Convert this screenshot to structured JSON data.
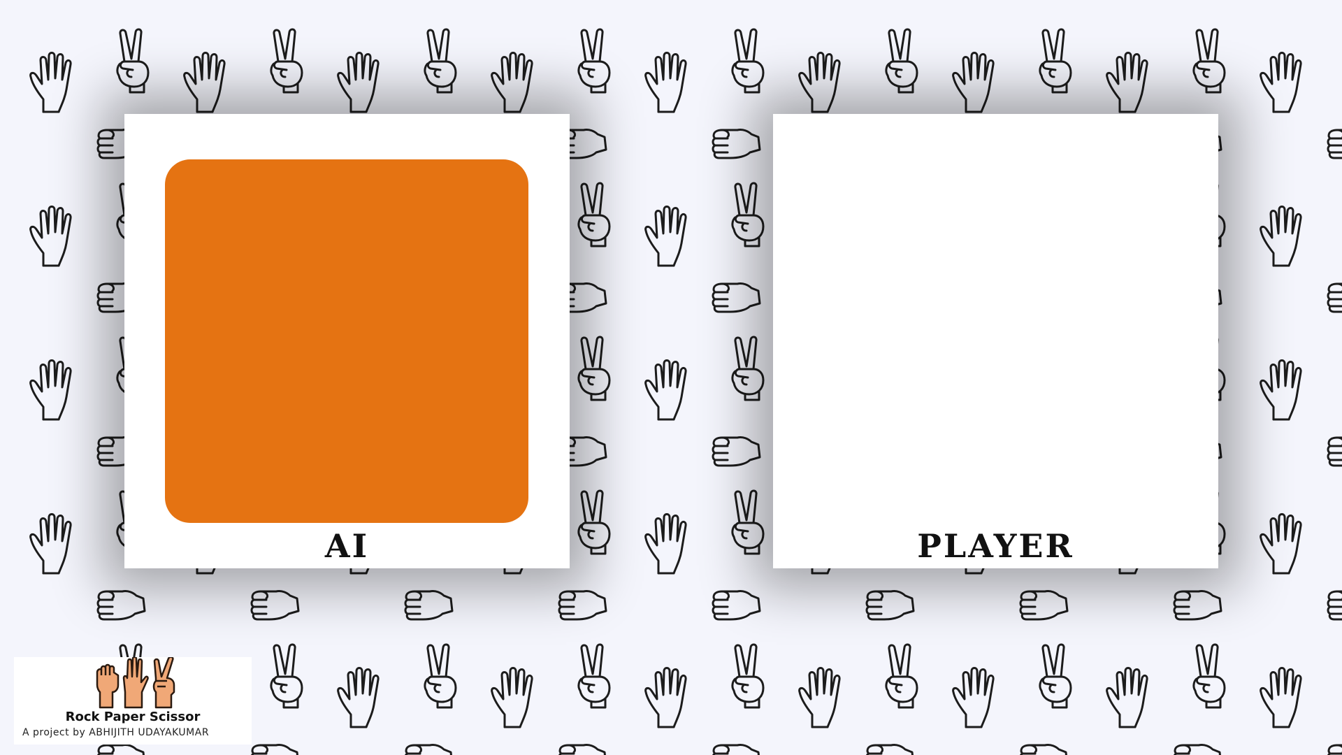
{
  "game": {
    "ai_label": "AI",
    "player_label": "PLAYER",
    "ai_choice_color": "#e57312",
    "panel_color": "#ffffff",
    "background_color": "#f4f5fc"
  },
  "background_pattern": {
    "icons": [
      "paper-hand-icon",
      "peace-scissor-hand-icon",
      "rock-fist-icon"
    ]
  },
  "footer": {
    "logo_icons": [
      "rock-fist-icon",
      "paper-hand-icon",
      "scissor-hand-icon"
    ],
    "title": "Rock Paper Scissor",
    "credit": "A project by ABHIJITH UDAYAKUMAR"
  }
}
